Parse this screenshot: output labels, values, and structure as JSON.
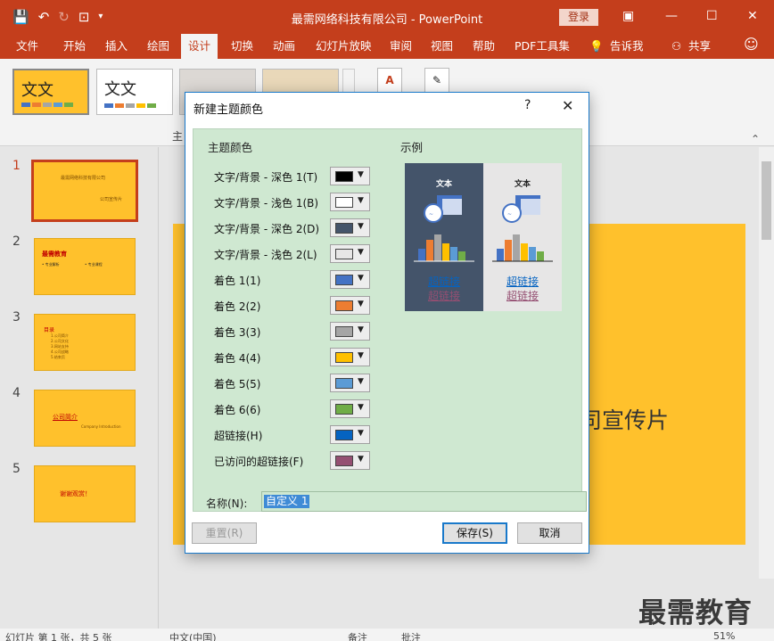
{
  "app": {
    "title": "最需网络科技有限公司 - PowerPoint",
    "login": "登录",
    "qat_icons": [
      "save-icon",
      "undo-icon",
      "redo-icon",
      "present-icon",
      "customize-icon"
    ]
  },
  "ribbon": {
    "tabs": [
      "文件",
      "开始",
      "插入",
      "绘图",
      "设计",
      "切换",
      "动画",
      "幻灯片放映",
      "审阅",
      "视图",
      "帮助",
      "PDF工具集",
      "告诉我",
      "共享"
    ],
    "active_tab": "设计",
    "theme_label": "文文",
    "group_label": "主"
  },
  "slides": [
    {
      "num": "1",
      "lines": [
        "最需网络科技有限公司",
        "公司宣传片"
      ]
    },
    {
      "num": "2",
      "lines": [
        "最需教育",
        "• 专业解析",
        "• 专业课程"
      ]
    },
    {
      "num": "3",
      "lines": [
        "目录",
        "1.公司简介",
        "2.公司文化",
        "3.网站支持",
        "4.公司战略",
        "5.结束页"
      ]
    },
    {
      "num": "4",
      "lines": [
        "公司简介",
        "Company Introduction"
      ]
    },
    {
      "num": "5",
      "lines": [
        "谢谢观赏！"
      ]
    }
  ],
  "canvas": {
    "visible_text": "司宣传片"
  },
  "watermark": "最需教育",
  "status": {
    "slide_info": "幻灯片 第 1 张，共 5 张",
    "language": "中文(中国)",
    "notes": "备注",
    "comments": "批注",
    "zoom": "51%"
  },
  "dialog": {
    "title": "新建主题颜色",
    "help": "?",
    "close": "✕",
    "section_colors": "主题颜色",
    "section_sample": "示例",
    "rows": [
      {
        "label": "文字/背景 - 深色 1(T)",
        "color": "#000000"
      },
      {
        "label": "文字/背景 - 浅色 1(B)",
        "color": "#ffffff"
      },
      {
        "label": "文字/背景 - 深色 2(D)",
        "color": "#44546a"
      },
      {
        "label": "文字/背景 - 浅色 2(L)",
        "color": "#e7e6e6"
      },
      {
        "label": "着色 1(1)",
        "color": "#4472c4"
      },
      {
        "label": "着色 2(2)",
        "color": "#ed7d31"
      },
      {
        "label": "着色 3(3)",
        "color": "#a5a5a5"
      },
      {
        "label": "着色 4(4)",
        "color": "#ffc000"
      },
      {
        "label": "着色 5(5)",
        "color": "#5b9bd5"
      },
      {
        "label": "着色 6(6)",
        "color": "#70ad47"
      },
      {
        "label": "超链接(H)",
        "color": "#0563c1"
      },
      {
        "label": "已访问的超链接(F)",
        "color": "#954f72"
      }
    ],
    "preview": {
      "text_label": "文本",
      "hyperlink": "超链接",
      "visited_hyperlink": "超链接"
    },
    "name_label": "名称(N):",
    "name_value": "自定义 1",
    "reset_button": "重置(R)",
    "save_button": "保存(S)",
    "cancel_button": "取消"
  }
}
